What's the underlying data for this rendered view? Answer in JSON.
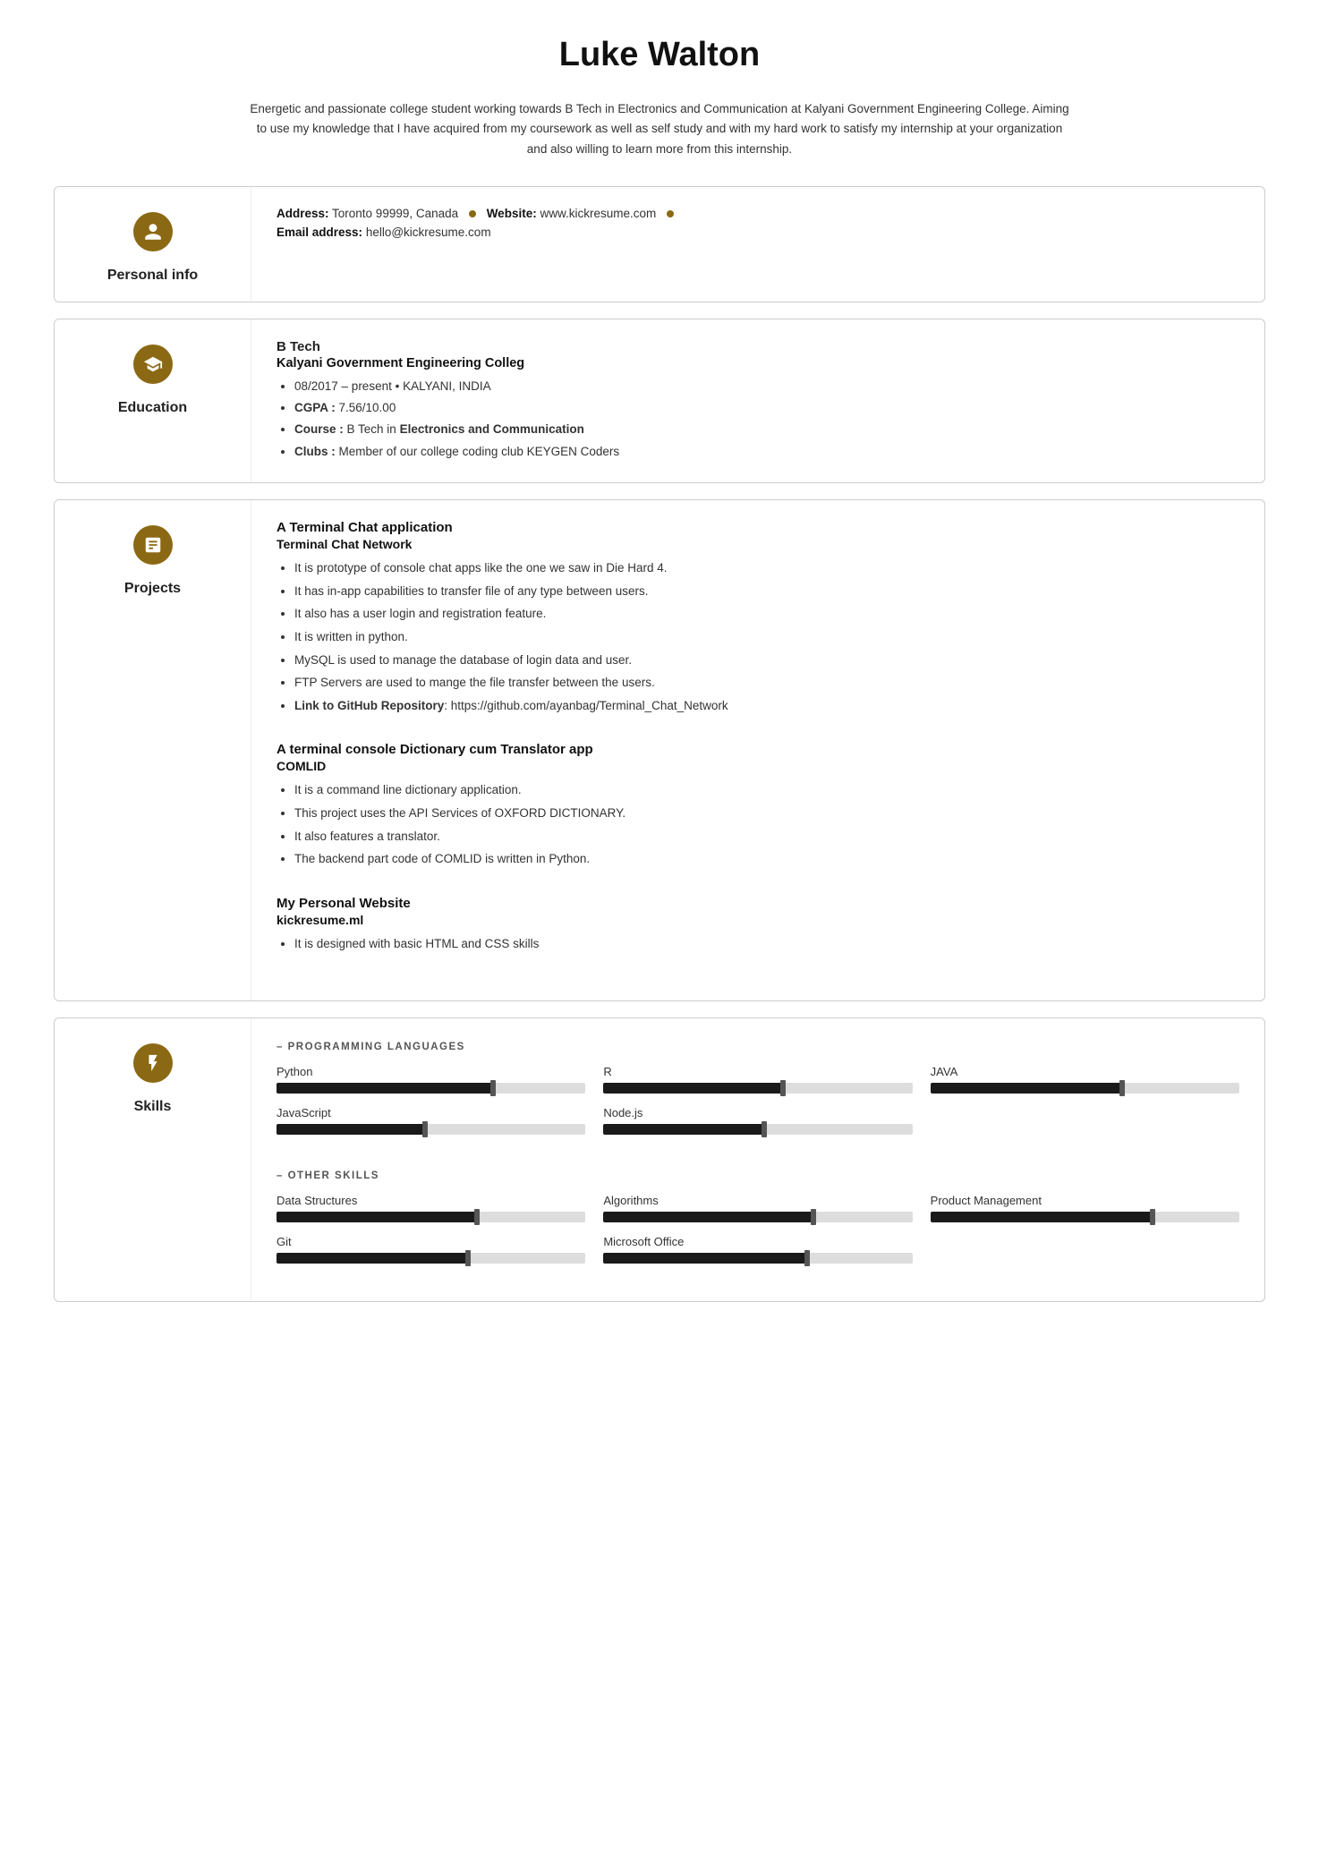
{
  "resume": {
    "name": "Luke Walton",
    "summary": "Energetic and passionate college student working towards B Tech in Electronics and Communication at Kalyani Government Engineering College. Aiming to use my knowledge that I have acquired from my coursework as well as self study and with my hard work to satisfy my internship at your organization and also willing to learn more from this internship.",
    "personal_info": {
      "label": "Personal info",
      "icon": "👤",
      "address": "Toronto 99999, Canada",
      "website_label": "Website:",
      "website": "www.kickresume.com",
      "email_label": "Email address:",
      "email": "hello@kickresume.com"
    },
    "education": {
      "label": "Education",
      "icon": "🎓",
      "degree": "B Tech",
      "school": "Kalyani Government Engineering Colleg",
      "items": [
        "08/2017 – present • KALYANI, INDIA",
        "CGPA : 7.56/10.00",
        "Course : B Tech in Electronics and Communication",
        "Clubs : Member of our college coding club KEYGEN Coders"
      ]
    },
    "projects": {
      "label": "Projects",
      "icon": "📋",
      "list": [
        {
          "title": "A Terminal Chat application",
          "subtitle": "Terminal Chat Network",
          "items": [
            "",
            "It is prototype of console chat apps like the one we saw in Die Hard 4.",
            "It has in-app capabilities to transfer file of any type between users.",
            "It also has a user login and registration feature.",
            "It is written in python.",
            "MySQL is used to manage the database of login data and user.",
            "FTP Servers are used to mange the file transfer between the users.",
            "Link to GitHub Repository: https://github.com/ayanbag/Terminal_Chat_Network"
          ]
        },
        {
          "title": "A terminal console Dictionary cum Translator app",
          "subtitle": "COMLID",
          "items": [
            "",
            "It is a command line dictionary application.",
            "This project uses the API Services of OXFORD DICTIONARY.",
            "It also features a translator.",
            "The backend part code of COMLID is written in Python."
          ]
        },
        {
          "title": "My Personal Website",
          "subtitle": "kickresume.ml",
          "items": [
            "",
            "It is designed with basic HTML and CSS skills"
          ]
        }
      ]
    },
    "skills": {
      "label": "Skills",
      "icon": "🔬",
      "programming_label": "– PROGRAMMING LANGUAGES",
      "programming": [
        {
          "name": "Python",
          "fill": 70
        },
        {
          "name": "R",
          "fill": 58
        },
        {
          "name": "JAVA",
          "fill": 62
        },
        {
          "name": "JavaScript",
          "fill": 48
        },
        {
          "name": "Node.js",
          "fill": 52
        }
      ],
      "other_label": "– OTHER SKILLS",
      "other": [
        {
          "name": "Data Structures",
          "fill": 65
        },
        {
          "name": "Algorithms",
          "fill": 68
        },
        {
          "name": "Product Management",
          "fill": 72
        },
        {
          "name": "Git",
          "fill": 62
        },
        {
          "name": "Microsoft Office",
          "fill": 66
        }
      ]
    }
  }
}
